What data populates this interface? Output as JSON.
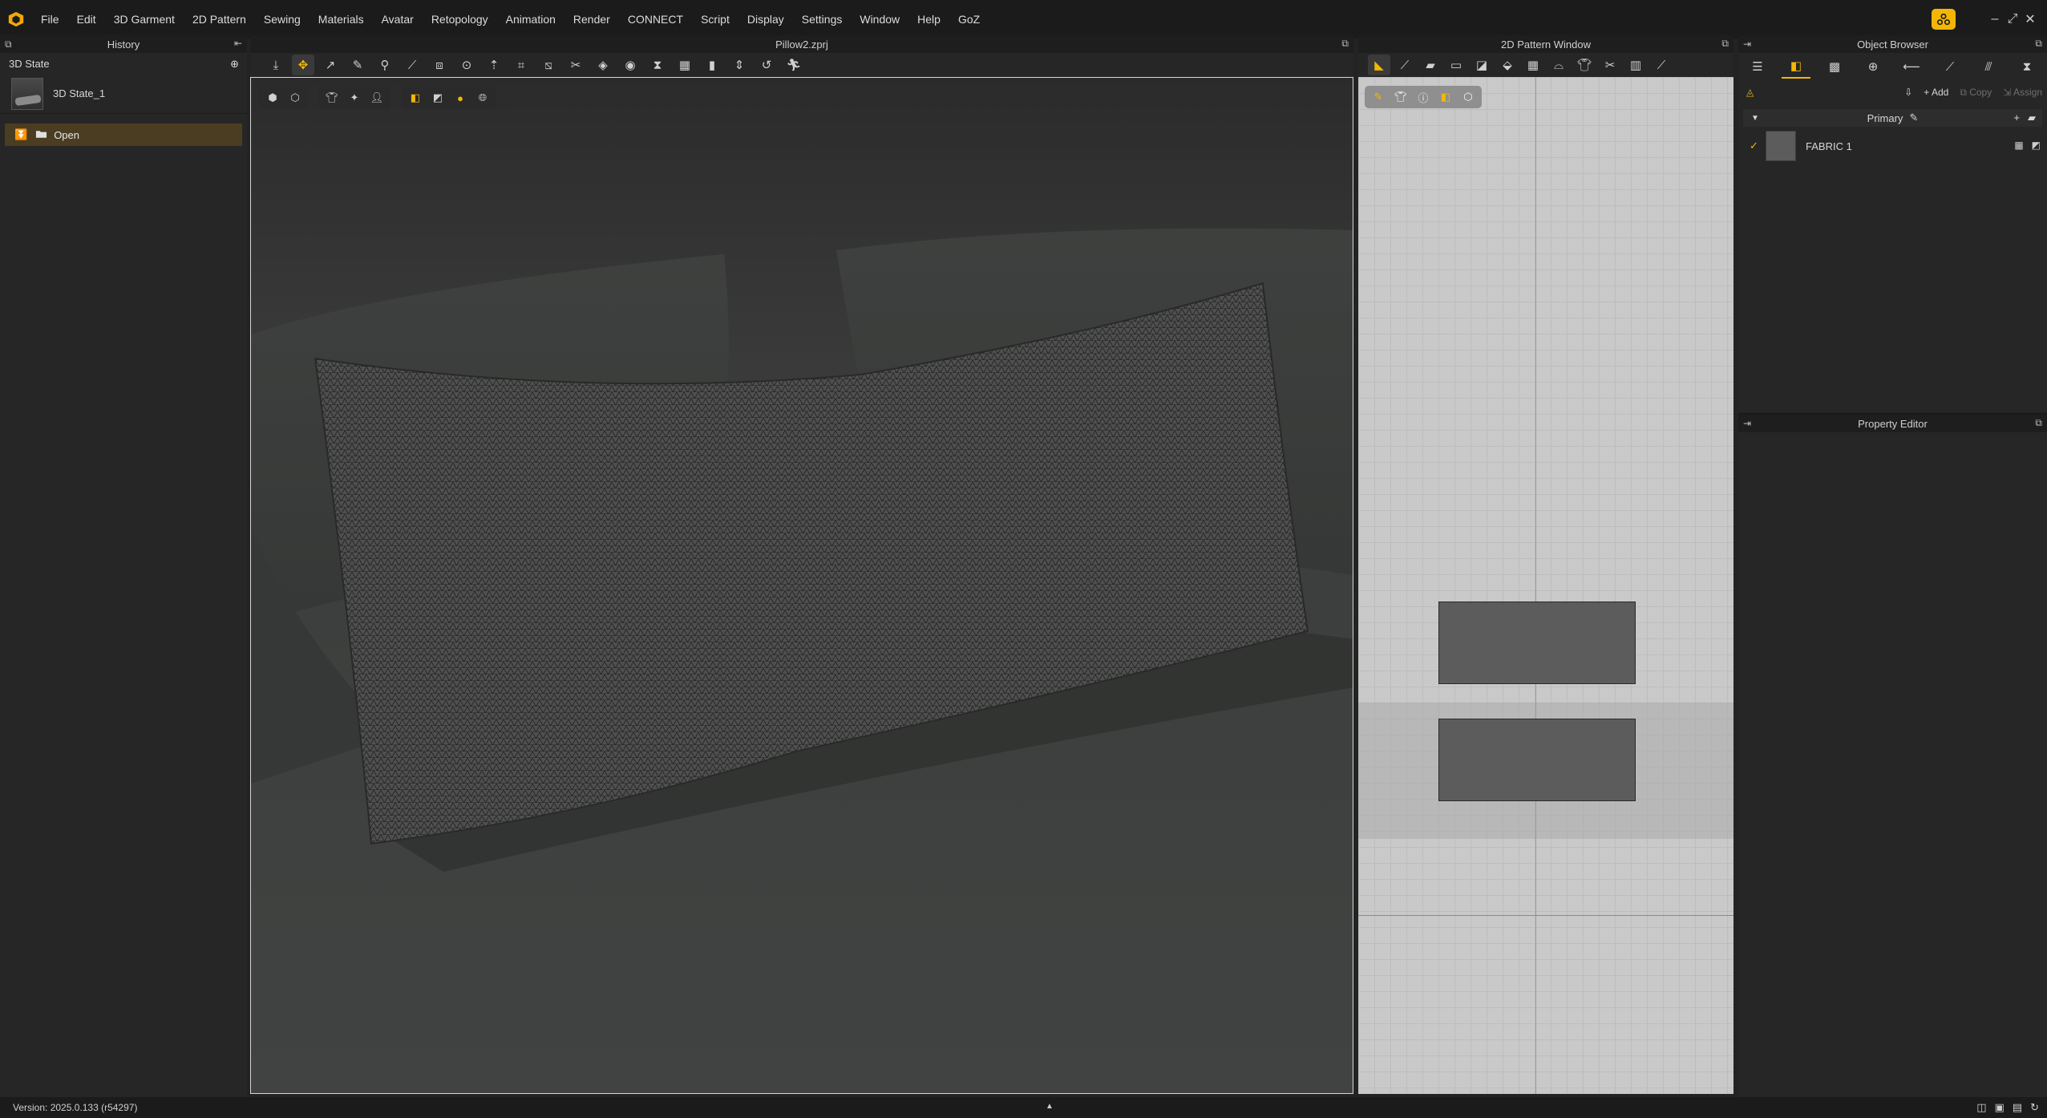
{
  "menubar": {
    "items": [
      "File",
      "Edit",
      "3D Garment",
      "2D Pattern",
      "Sewing",
      "Materials",
      "Avatar",
      "Retopology",
      "Animation",
      "Render",
      "CONNECT",
      "Script",
      "Display",
      "Settings",
      "Window",
      "Help",
      "GoZ"
    ],
    "window_controls": [
      "–",
      "⤢",
      "✕"
    ]
  },
  "history": {
    "title": "History",
    "state_header": "3D State",
    "state_name": "3D State_1",
    "open_label": "Open"
  },
  "view3d": {
    "file_title": "Pillow2.zprj"
  },
  "view2d": {
    "title": "2D Pattern Window"
  },
  "object_browser": {
    "title": "Object Browser",
    "add_label": "Add",
    "copy_label": "Copy",
    "assign_label": "Assign",
    "group_label": "Primary",
    "fabric_name": "FABRIC 1"
  },
  "property_editor": {
    "title": "Property Editor"
  },
  "status": {
    "version": "Version: 2025.0.133 (r54297)"
  },
  "colors": {
    "accent": "#f2b705",
    "open_row": "#4b3d22",
    "background": "#232323"
  }
}
